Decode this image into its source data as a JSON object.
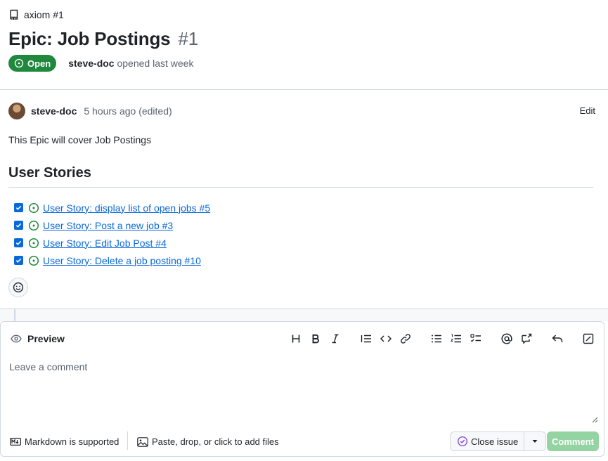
{
  "header": {
    "repo_crumb": "axiom #1",
    "title": "Epic: Job Postings",
    "number": "#1",
    "state": "Open",
    "author": "steve-doc",
    "opened_text": "opened last week"
  },
  "comment": {
    "author": "steve-doc",
    "time": "5 hours ago (edited)",
    "edit_label": "Edit",
    "body": "This Epic will cover Job Postings",
    "section_heading": "User Stories",
    "tasks": [
      {
        "label": "User Story: display list of open jobs #5",
        "checked": true
      },
      {
        "label": "User Story: Post a new job #3",
        "checked": true
      },
      {
        "label": "User Story: Edit Job Post #4",
        "checked": true
      },
      {
        "label": "User Story: Delete a job posting #10",
        "checked": true
      }
    ]
  },
  "editor": {
    "tab_label": "Preview",
    "placeholder": "Leave a comment",
    "markdown_hint": "Markdown is supported",
    "files_hint": "Paste, drop, or click to add files",
    "close_issue_label": "Close issue",
    "comment_label": "Comment",
    "toolbar_icons": [
      "heading-icon",
      "bold-icon",
      "italic-icon",
      "quote-icon",
      "code-icon",
      "link-icon",
      "unordered-list-icon",
      "ordered-list-icon",
      "task-list-icon",
      "mention-icon",
      "cross-reference-icon",
      "saved-reply-icon",
      "fullscreen-icon"
    ]
  },
  "colors": {
    "open_green": "#1f883d",
    "link_blue": "#0969da",
    "comment_disabled": "#94d3a2",
    "close_purple": "#8250df"
  }
}
